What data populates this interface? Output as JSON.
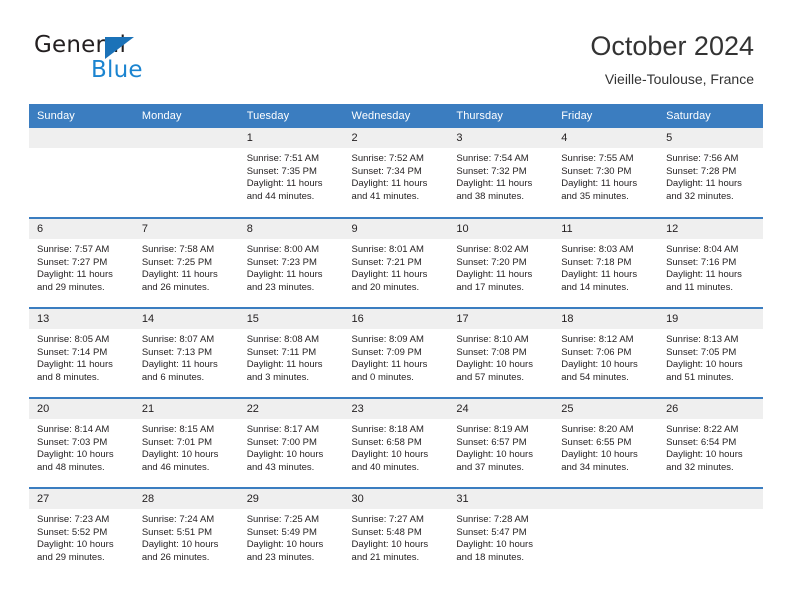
{
  "brand": {
    "name_part1": "General",
    "name_part2": "Blue",
    "triangle_color": "#1b72b8",
    "blue_color": "#1b84d0"
  },
  "header": {
    "title": "October 2024",
    "subtitle": "Vieille-Toulouse, France"
  },
  "theme": {
    "header_blue": "#3b7dc0",
    "daynum_background": "#efefef",
    "text_color": "#231f20"
  },
  "weekday_headers": [
    "Sunday",
    "Monday",
    "Tuesday",
    "Wednesday",
    "Thursday",
    "Friday",
    "Saturday"
  ],
  "weeks": [
    [
      {
        "day": "",
        "sunrise": "",
        "sunset": "",
        "daylight1": "",
        "daylight2": "",
        "empty": true
      },
      {
        "day": "",
        "sunrise": "",
        "sunset": "",
        "daylight1": "",
        "daylight2": "",
        "empty": true
      },
      {
        "day": "1",
        "sunrise": "Sunrise: 7:51 AM",
        "sunset": "Sunset: 7:35 PM",
        "daylight1": "Daylight: 11 hours",
        "daylight2": "and 44 minutes."
      },
      {
        "day": "2",
        "sunrise": "Sunrise: 7:52 AM",
        "sunset": "Sunset: 7:34 PM",
        "daylight1": "Daylight: 11 hours",
        "daylight2": "and 41 minutes."
      },
      {
        "day": "3",
        "sunrise": "Sunrise: 7:54 AM",
        "sunset": "Sunset: 7:32 PM",
        "daylight1": "Daylight: 11 hours",
        "daylight2": "and 38 minutes."
      },
      {
        "day": "4",
        "sunrise": "Sunrise: 7:55 AM",
        "sunset": "Sunset: 7:30 PM",
        "daylight1": "Daylight: 11 hours",
        "daylight2": "and 35 minutes."
      },
      {
        "day": "5",
        "sunrise": "Sunrise: 7:56 AM",
        "sunset": "Sunset: 7:28 PM",
        "daylight1": "Daylight: 11 hours",
        "daylight2": "and 32 minutes."
      }
    ],
    [
      {
        "day": "6",
        "sunrise": "Sunrise: 7:57 AM",
        "sunset": "Sunset: 7:27 PM",
        "daylight1": "Daylight: 11 hours",
        "daylight2": "and 29 minutes."
      },
      {
        "day": "7",
        "sunrise": "Sunrise: 7:58 AM",
        "sunset": "Sunset: 7:25 PM",
        "daylight1": "Daylight: 11 hours",
        "daylight2": "and 26 minutes."
      },
      {
        "day": "8",
        "sunrise": "Sunrise: 8:00 AM",
        "sunset": "Sunset: 7:23 PM",
        "daylight1": "Daylight: 11 hours",
        "daylight2": "and 23 minutes."
      },
      {
        "day": "9",
        "sunrise": "Sunrise: 8:01 AM",
        "sunset": "Sunset: 7:21 PM",
        "daylight1": "Daylight: 11 hours",
        "daylight2": "and 20 minutes."
      },
      {
        "day": "10",
        "sunrise": "Sunrise: 8:02 AM",
        "sunset": "Sunset: 7:20 PM",
        "daylight1": "Daylight: 11 hours",
        "daylight2": "and 17 minutes."
      },
      {
        "day": "11",
        "sunrise": "Sunrise: 8:03 AM",
        "sunset": "Sunset: 7:18 PM",
        "daylight1": "Daylight: 11 hours",
        "daylight2": "and 14 minutes."
      },
      {
        "day": "12",
        "sunrise": "Sunrise: 8:04 AM",
        "sunset": "Sunset: 7:16 PM",
        "daylight1": "Daylight: 11 hours",
        "daylight2": "and 11 minutes."
      }
    ],
    [
      {
        "day": "13",
        "sunrise": "Sunrise: 8:05 AM",
        "sunset": "Sunset: 7:14 PM",
        "daylight1": "Daylight: 11 hours",
        "daylight2": "and 8 minutes."
      },
      {
        "day": "14",
        "sunrise": "Sunrise: 8:07 AM",
        "sunset": "Sunset: 7:13 PM",
        "daylight1": "Daylight: 11 hours",
        "daylight2": "and 6 minutes."
      },
      {
        "day": "15",
        "sunrise": "Sunrise: 8:08 AM",
        "sunset": "Sunset: 7:11 PM",
        "daylight1": "Daylight: 11 hours",
        "daylight2": "and 3 minutes."
      },
      {
        "day": "16",
        "sunrise": "Sunrise: 8:09 AM",
        "sunset": "Sunset: 7:09 PM",
        "daylight1": "Daylight: 11 hours",
        "daylight2": "and 0 minutes."
      },
      {
        "day": "17",
        "sunrise": "Sunrise: 8:10 AM",
        "sunset": "Sunset: 7:08 PM",
        "daylight1": "Daylight: 10 hours",
        "daylight2": "and 57 minutes."
      },
      {
        "day": "18",
        "sunrise": "Sunrise: 8:12 AM",
        "sunset": "Sunset: 7:06 PM",
        "daylight1": "Daylight: 10 hours",
        "daylight2": "and 54 minutes."
      },
      {
        "day": "19",
        "sunrise": "Sunrise: 8:13 AM",
        "sunset": "Sunset: 7:05 PM",
        "daylight1": "Daylight: 10 hours",
        "daylight2": "and 51 minutes."
      }
    ],
    [
      {
        "day": "20",
        "sunrise": "Sunrise: 8:14 AM",
        "sunset": "Sunset: 7:03 PM",
        "daylight1": "Daylight: 10 hours",
        "daylight2": "and 48 minutes."
      },
      {
        "day": "21",
        "sunrise": "Sunrise: 8:15 AM",
        "sunset": "Sunset: 7:01 PM",
        "daylight1": "Daylight: 10 hours",
        "daylight2": "and 46 minutes."
      },
      {
        "day": "22",
        "sunrise": "Sunrise: 8:17 AM",
        "sunset": "Sunset: 7:00 PM",
        "daylight1": "Daylight: 10 hours",
        "daylight2": "and 43 minutes."
      },
      {
        "day": "23",
        "sunrise": "Sunrise: 8:18 AM",
        "sunset": "Sunset: 6:58 PM",
        "daylight1": "Daylight: 10 hours",
        "daylight2": "and 40 minutes."
      },
      {
        "day": "24",
        "sunrise": "Sunrise: 8:19 AM",
        "sunset": "Sunset: 6:57 PM",
        "daylight1": "Daylight: 10 hours",
        "daylight2": "and 37 minutes."
      },
      {
        "day": "25",
        "sunrise": "Sunrise: 8:20 AM",
        "sunset": "Sunset: 6:55 PM",
        "daylight1": "Daylight: 10 hours",
        "daylight2": "and 34 minutes."
      },
      {
        "day": "26",
        "sunrise": "Sunrise: 8:22 AM",
        "sunset": "Sunset: 6:54 PM",
        "daylight1": "Daylight: 10 hours",
        "daylight2": "and 32 minutes."
      }
    ],
    [
      {
        "day": "27",
        "sunrise": "Sunrise: 7:23 AM",
        "sunset": "Sunset: 5:52 PM",
        "daylight1": "Daylight: 10 hours",
        "daylight2": "and 29 minutes."
      },
      {
        "day": "28",
        "sunrise": "Sunrise: 7:24 AM",
        "sunset": "Sunset: 5:51 PM",
        "daylight1": "Daylight: 10 hours",
        "daylight2": "and 26 minutes."
      },
      {
        "day": "29",
        "sunrise": "Sunrise: 7:25 AM",
        "sunset": "Sunset: 5:49 PM",
        "daylight1": "Daylight: 10 hours",
        "daylight2": "and 23 minutes."
      },
      {
        "day": "30",
        "sunrise": "Sunrise: 7:27 AM",
        "sunset": "Sunset: 5:48 PM",
        "daylight1": "Daylight: 10 hours",
        "daylight2": "and 21 minutes."
      },
      {
        "day": "31",
        "sunrise": "Sunrise: 7:28 AM",
        "sunset": "Sunset: 5:47 PM",
        "daylight1": "Daylight: 10 hours",
        "daylight2": "and 18 minutes."
      },
      {
        "day": "",
        "sunrise": "",
        "sunset": "",
        "daylight1": "",
        "daylight2": "",
        "empty": true
      },
      {
        "day": "",
        "sunrise": "",
        "sunset": "",
        "daylight1": "",
        "daylight2": "",
        "empty": true
      }
    ]
  ]
}
